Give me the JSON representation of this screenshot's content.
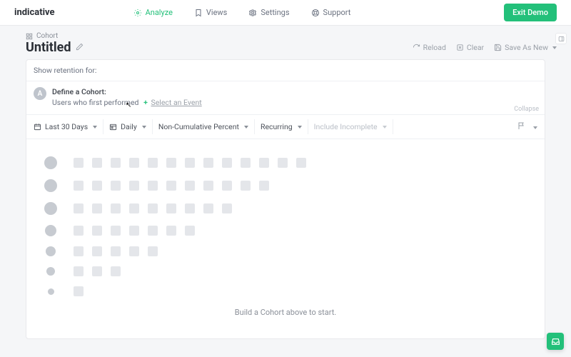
{
  "brand": "indicative",
  "nav": {
    "analyze": "Analyze",
    "views": "Views",
    "settings": "Settings",
    "support": "Support"
  },
  "exit_label": "Exit Demo",
  "breadcrumb": "Cohort",
  "title": "Untitled",
  "actions": {
    "reload": "Reload",
    "clear": "Clear",
    "save_as_new": "Save As New"
  },
  "show_retention_label": "Show retention for:",
  "cohort": {
    "badge": "A",
    "define": "Define a Cohort:",
    "users_performed": "Users who first performed",
    "select_event": "Select an Event",
    "collapse": "Collapse"
  },
  "filters": {
    "date_range": "Last 30 Days",
    "granularity": "Daily",
    "metric": "Non-Cumulative Percent",
    "recurring": "Recurring",
    "include_incomplete": "Include Incomplete"
  },
  "empty_message": "Build a Cohort above to start.",
  "chart_data": {
    "type": "heatmap",
    "note": "empty-state skeleton retention grid",
    "rows": [
      {
        "dotSize": 18,
        "cells": 13
      },
      {
        "dotSize": 18,
        "cells": 11
      },
      {
        "dotSize": 18,
        "cells": 9
      },
      {
        "dotSize": 16,
        "cells": 7
      },
      {
        "dotSize": 14,
        "cells": 5
      },
      {
        "dotSize": 12,
        "cells": 3
      },
      {
        "dotSize": 9,
        "cells": 1
      }
    ]
  }
}
